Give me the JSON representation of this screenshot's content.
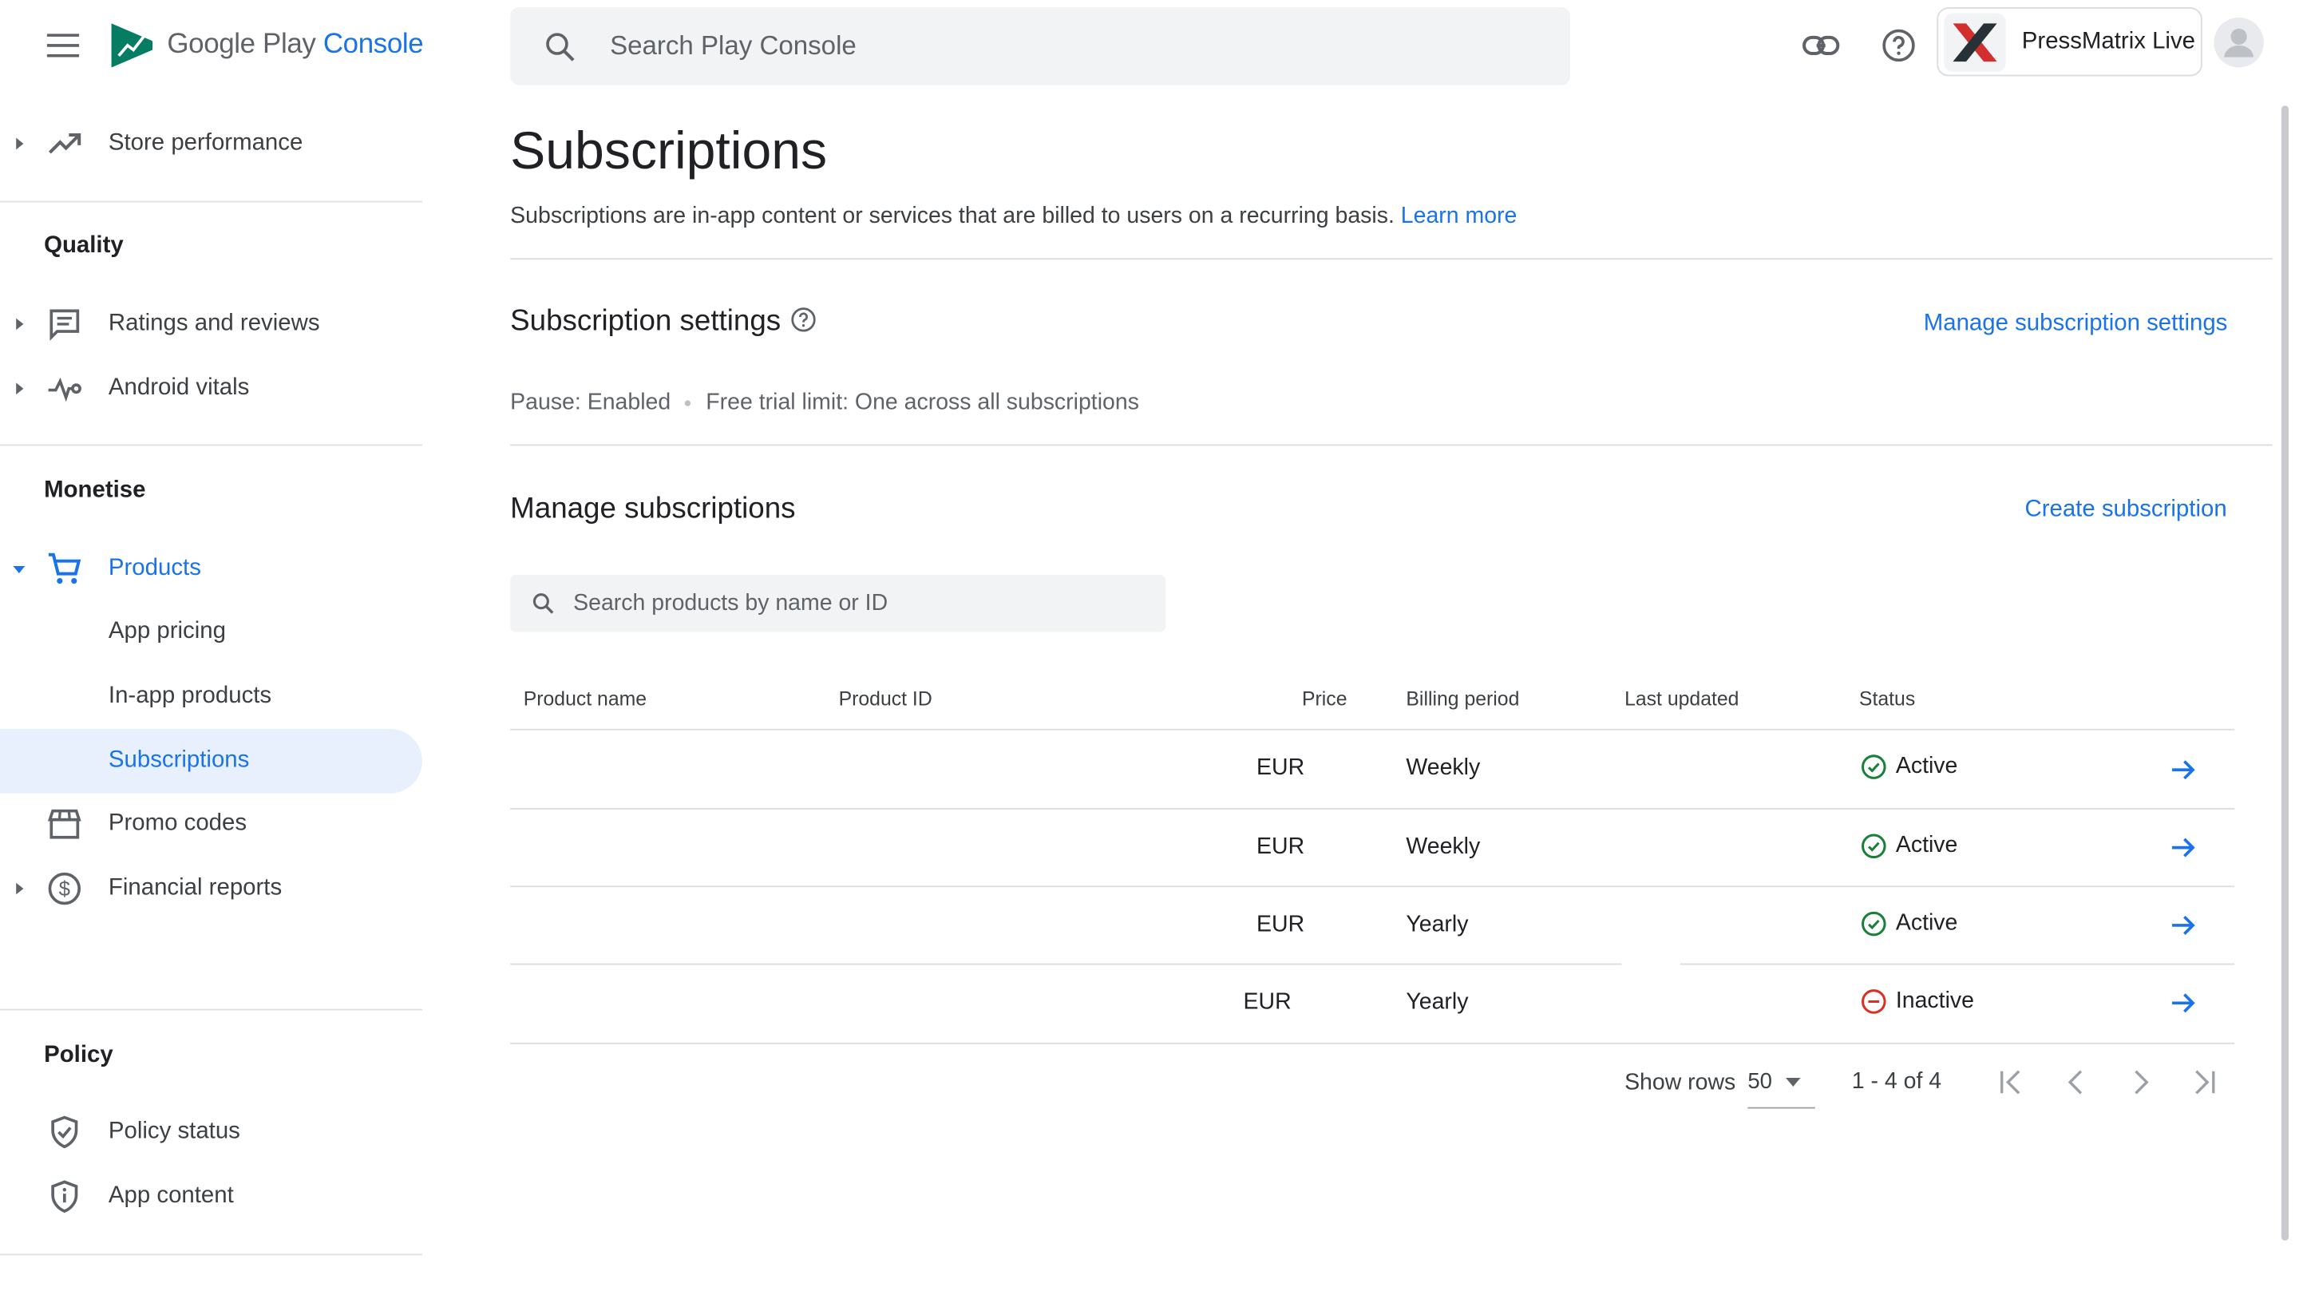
{
  "app": {
    "logo_word1": "Google Play",
    "logo_word2": "Console",
    "search_placeholder": "Search Play Console",
    "account_name": "PressMatrix Live",
    "accent_color": "#1a73e8"
  },
  "sidebar": {
    "store_performance": "Store performance",
    "section_quality": "Quality",
    "ratings_reviews": "Ratings and reviews",
    "android_vitals": "Android vitals",
    "section_monetise": "Monetise",
    "products": "Products",
    "app_pricing": "App pricing",
    "in_app_products": "In-app products",
    "subscriptions": "Subscriptions",
    "promo_codes": "Promo codes",
    "financial_reports": "Financial reports",
    "section_policy": "Policy",
    "policy_status": "Policy status",
    "app_content": "App content"
  },
  "main": {
    "title": "Subscriptions",
    "description": "Subscriptions are in-app content or services that are billed to users on a recurring basis.",
    "learn_more": "Learn more",
    "settings_title": "Subscription settings",
    "manage_settings_link": "Manage subscription settings",
    "pause_text": "Pause: Enabled",
    "free_trial_text": "Free trial limit: One across all subscriptions",
    "manage_title": "Manage subscriptions",
    "create_link": "Create subscription",
    "product_search_placeholder": "Search products by name or ID"
  },
  "table": {
    "headers": {
      "product_name": "Product name",
      "product_id": "Product ID",
      "price": "Price",
      "billing_period": "Billing period",
      "last_updated": "Last updated",
      "status": "Status"
    },
    "rows": [
      {
        "product_name": "",
        "product_id": "",
        "price": "EUR",
        "billing_period": "Weekly",
        "last_updated": "",
        "status": "Active"
      },
      {
        "product_name": "",
        "product_id": "",
        "price": "EUR",
        "billing_period": "Weekly",
        "last_updated": "",
        "status": "Active"
      },
      {
        "product_name": "",
        "product_id": "",
        "price": "EUR",
        "billing_period": "Yearly",
        "last_updated": "",
        "status": "Active"
      },
      {
        "product_name": "",
        "product_id": "",
        "price": "EUR",
        "billing_period": "Yearly",
        "last_updated": "",
        "status": "Inactive"
      }
    ]
  },
  "pagination": {
    "show_rows_label": "Show rows",
    "rows_value": "50",
    "range_text": "1 - 4 of 4"
  },
  "status_colors": {
    "active": "#188038",
    "inactive": "#d93025"
  }
}
